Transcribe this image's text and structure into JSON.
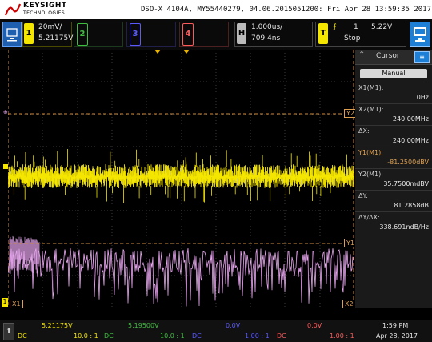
{
  "header": {
    "brand": "KEYSIGHT",
    "brand_sub": "TECHNOLOGIES",
    "scope_id": "DSO-X 4104A, MY55440279, 04.06.2015051200: Fri Apr 28 13:59:35 2017"
  },
  "channels": [
    {
      "num": "1",
      "scale": "20mV/",
      "offset": "5.21175V",
      "color": "#f5e600"
    },
    {
      "num": "2",
      "color": "#3fbf3f"
    },
    {
      "num": "3",
      "color": "#5a5aff"
    },
    {
      "num": "4",
      "color": "#ff5a5a"
    }
  ],
  "timebase": {
    "label": "H",
    "scale": "1.000us/",
    "delay": "709.4ns"
  },
  "trigger": {
    "label": "T",
    "channel": "1",
    "level": "5.22V",
    "state": "Stop"
  },
  "grid_markers": {
    "y2": "Y2",
    "y1": "Y1",
    "x1": "X1",
    "x2": "X2",
    "ch1": "1"
  },
  "cursor_panel": {
    "title": "Cursor",
    "mode": "Manual",
    "rows": [
      {
        "label": "X1(M1):",
        "value": "0Hz"
      },
      {
        "label": "X2(M1):",
        "value": "240.00MHz"
      },
      {
        "label": "ΔX:",
        "value": "240.00MHz"
      },
      {
        "label": "Y1(M1):",
        "value": "-81.2500dBV"
      },
      {
        "label": "Y2(M1):",
        "value": "35.7500mdBV"
      },
      {
        "label": "ΔY:",
        "value": "81.2858dB"
      },
      {
        "label": "ΔY/ΔX:",
        "value": "338.691ndB/Hz"
      }
    ]
  },
  "bottom": {
    "ch1": {
      "value": "5.21175V",
      "coupling": "DC",
      "ratio": "10.0 : 1"
    },
    "ch2": {
      "value": "5.19500V",
      "coupling": "DC",
      "ratio": "10.0 : 1"
    },
    "ch3": {
      "value": "0.0V",
      "coupling": "DC",
      "ratio": "1.00 : 1"
    },
    "ch4": {
      "value": "0.0V",
      "coupling": "DC",
      "ratio": "1.00 : 1"
    },
    "time": "1:59 PM",
    "date": "Apr 28, 2017"
  },
  "colors": {
    "ch1": "#f5e600",
    "ch2": "#3fbf3f",
    "ch3": "#5a5aff",
    "ch4": "#ff5a5a",
    "math": "#e9a7f0",
    "accent": "#1e7fd6"
  },
  "icons": [
    "keysight-logo",
    "channel-toggle-icon",
    "scroll-arrow-up-icon",
    "screen-icon",
    "cursor-menu-icon"
  ]
}
